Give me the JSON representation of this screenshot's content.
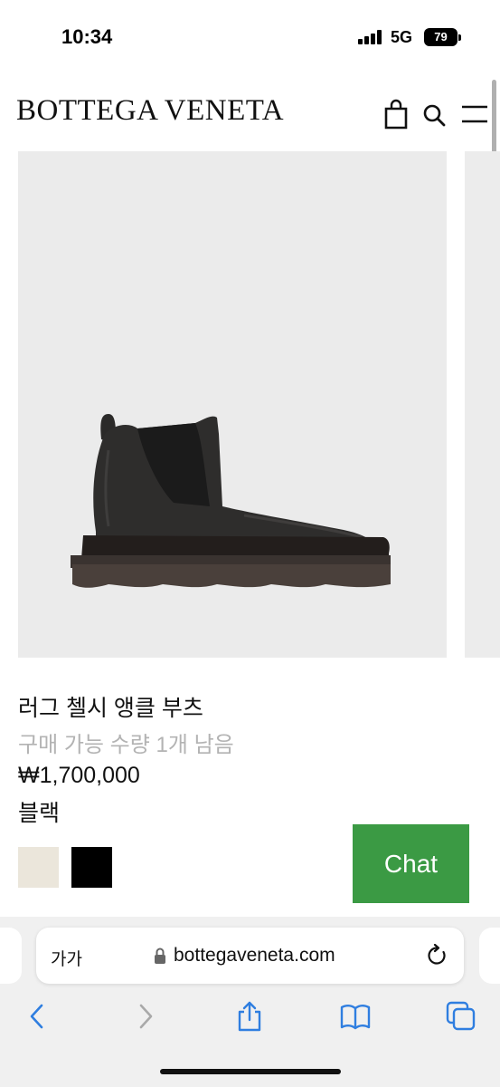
{
  "status_bar": {
    "time": "10:34",
    "network": "5G",
    "battery": "79"
  },
  "header": {
    "brand": "BOTTEGA VENETA",
    "icons": [
      "shopping-bag-icon",
      "search-icon",
      "menu-icon"
    ]
  },
  "product": {
    "name": "러그 첼시 앵클 부츠",
    "availability": "구매 가능 수량 1개 남음",
    "price": "₩1,700,000",
    "color": "블랙",
    "swatches": [
      {
        "name": "ivory",
        "color": "#ebe6db"
      },
      {
        "name": "black",
        "color": "#000000"
      }
    ]
  },
  "chat": {
    "label": "Chat",
    "color": "#3b9a44"
  },
  "browser": {
    "reader_label": "가가",
    "url": "bottegaveneta.com",
    "toolbar": [
      "back-icon",
      "forward-icon",
      "share-icon",
      "bookmarks-icon",
      "tabs-icon"
    ]
  }
}
